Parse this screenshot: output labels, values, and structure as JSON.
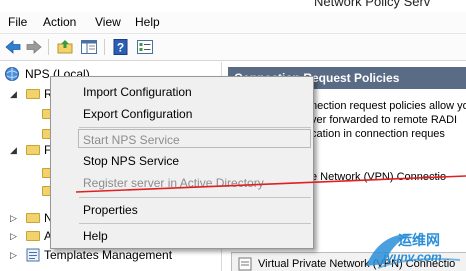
{
  "window": {
    "title": "Network Policy Serv"
  },
  "menu": {
    "file": "File",
    "action": "Action",
    "view": "View",
    "help": "Help"
  },
  "toolbar": {
    "buttons": [
      "back-arrow-icon",
      "forward-arrow-icon",
      "up-folder-icon",
      "show-hide-tree-icon",
      "help-icon",
      "properties-icon"
    ]
  },
  "tree": {
    "root": "NPS (Local)",
    "nodes": [
      "R",
      "F",
      "N",
      "A",
      "Templates Management"
    ]
  },
  "right": {
    "header": "Connection Request Policies",
    "desc": [
      "nection request policies allow yo",
      "ver forwarded to remote RADI",
      "cation in connection reques"
    ],
    "vpn_line": "e Network (VPN) Connectio",
    "bottom_item": "Virtual Private Network (VPN) Connectio"
  },
  "context_menu": {
    "import": "Import Configuration",
    "export": "Export Configuration",
    "start": "Start NPS Service",
    "stop": "Stop NPS Service",
    "register": "Register server in Active Directory",
    "properties": "Properties",
    "help": "Help"
  },
  "watermark": {
    "cn": "运维网",
    "url": "iyunv.com"
  },
  "colors": {
    "header_bg": "#5a6b86",
    "annotation": "#e02020",
    "watermark": "#2a8fd8"
  }
}
